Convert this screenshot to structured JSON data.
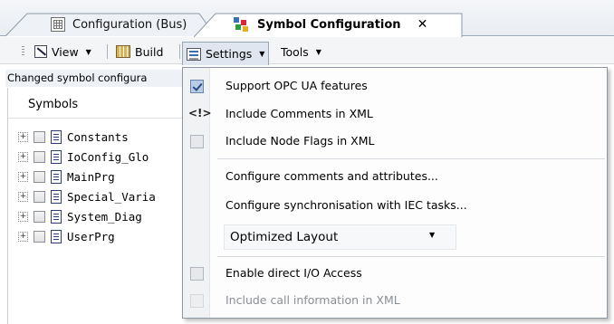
{
  "tabs": [
    {
      "label": "Configuration (Bus)",
      "active": false,
      "icon": "configuration-icon"
    },
    {
      "label": "Symbol Configuration",
      "active": true,
      "icon": "symbol-config-icon",
      "close": "✕"
    }
  ],
  "toolbar": {
    "view": {
      "label": "View",
      "icon": "view-icon"
    },
    "build": {
      "label": "Build",
      "icon": "build-icon"
    },
    "settings": {
      "label": "Settings",
      "icon": "settings-icon"
    },
    "tools": {
      "label": "Tools"
    }
  },
  "status_text": "Changed symbol configura",
  "tree": {
    "header": "Symbols",
    "items": [
      {
        "label": "Constants"
      },
      {
        "label": "IoConfig_Glo"
      },
      {
        "label": "MainPrg"
      },
      {
        "label": "Special_Varia"
      },
      {
        "label": "System_Diag"
      },
      {
        "label": "UserPrg"
      }
    ]
  },
  "settings_menu": {
    "items": [
      {
        "label": "Support OPC UA features",
        "check": "checked"
      },
      {
        "label": "Include Comments in XML",
        "glyph": "<!>"
      },
      {
        "label": "Include Node Flags in XML",
        "check": "unchecked"
      },
      {
        "label": "Configure comments and attributes..."
      },
      {
        "label": "Configure synchronisation with IEC tasks..."
      },
      {
        "label": "Enable direct I/O Access",
        "check": "unchecked"
      },
      {
        "label": "Include call information in XML",
        "check": "unchecked",
        "disabled": true
      }
    ],
    "layout_combo": {
      "value": "Optimized Layout"
    }
  },
  "colors": {
    "menu_check_fill": "#b9cde6",
    "active_tab_accent": "#3a6fb0",
    "disabled_text": "#8a8f95"
  }
}
